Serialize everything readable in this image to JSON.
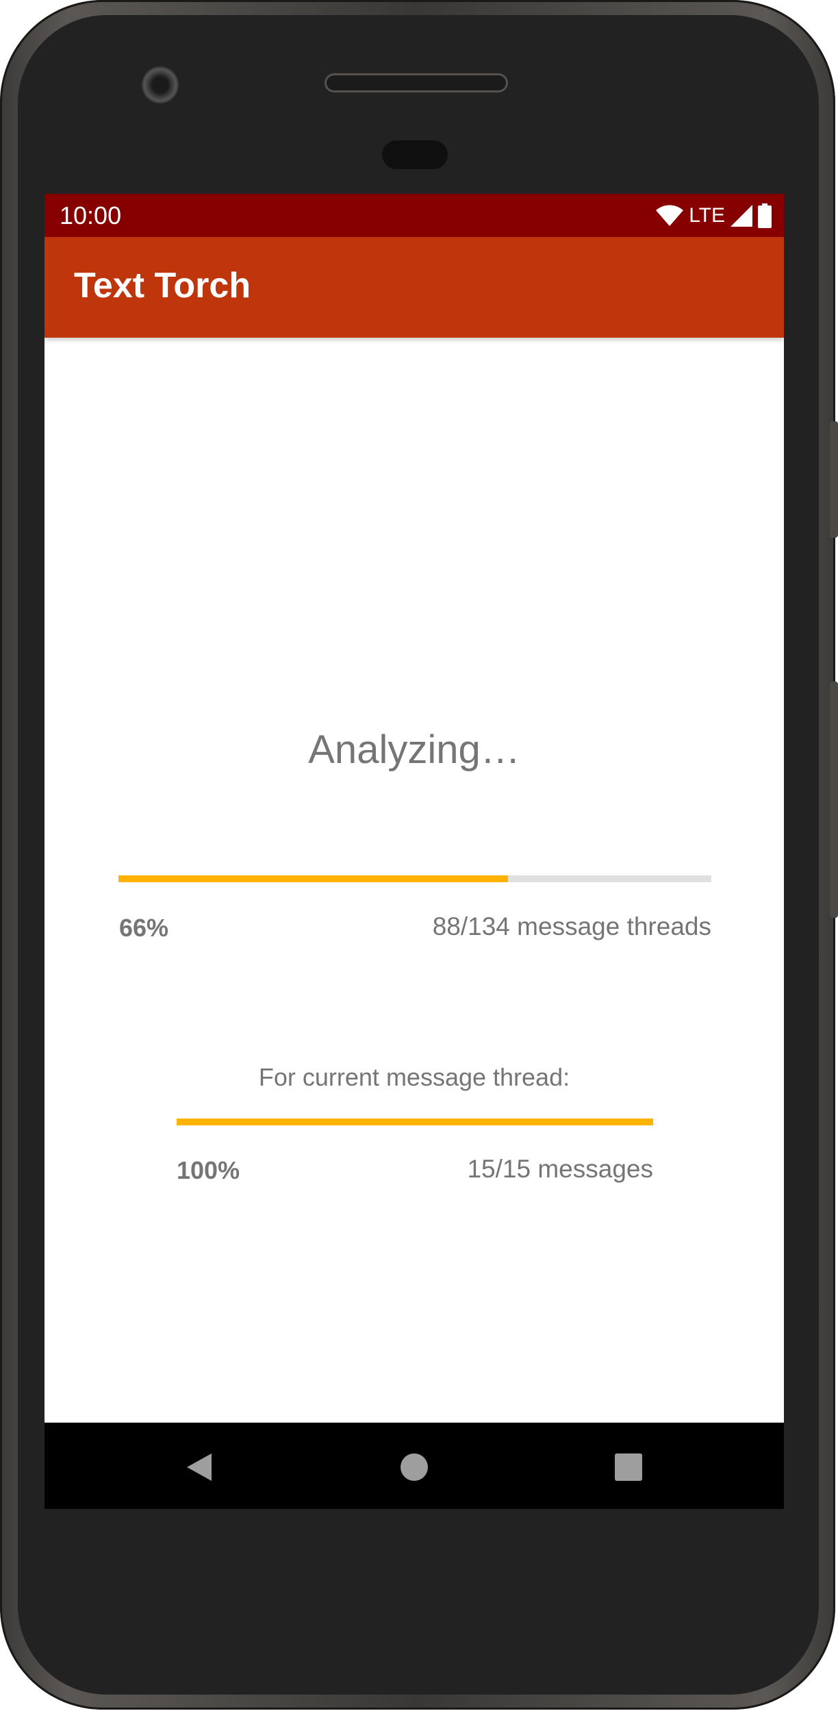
{
  "status_bar": {
    "time": "10:00",
    "network_label": "LTE",
    "icons": [
      "wifi-icon",
      "signal-icon",
      "battery-icon"
    ],
    "color": "#870000"
  },
  "app_bar": {
    "title": "Text Torch",
    "color": "#bf360c"
  },
  "main": {
    "heading": "Analyzing…",
    "overall_progress": {
      "percent_label": "66%",
      "fraction": 0.657,
      "count_label": "88/134 message threads"
    },
    "thread_caption": "For current message thread:",
    "thread_progress": {
      "percent_label": "100%",
      "fraction": 1.0,
      "count_label": "15/15 messages"
    },
    "accent_color": "#ffb300",
    "track_color": "#e0e0e0"
  },
  "nav_bar": {
    "buttons": [
      "back-icon",
      "home-icon",
      "recents-icon"
    ]
  }
}
